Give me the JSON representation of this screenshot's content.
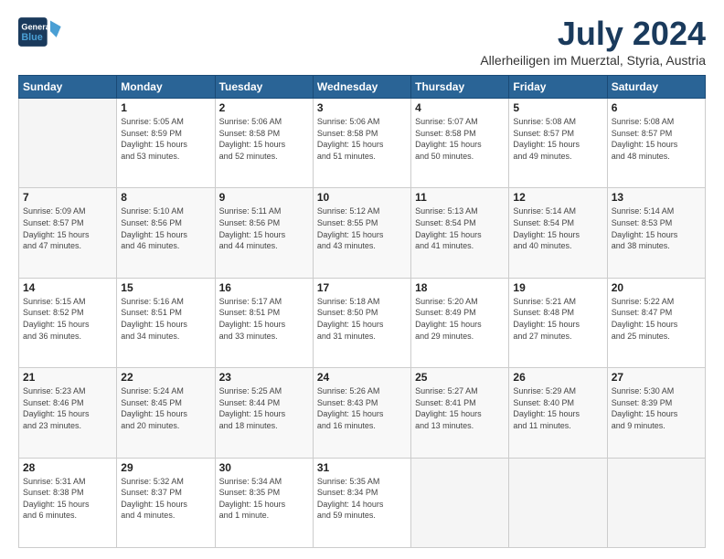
{
  "logo": {
    "line1": "General",
    "line2": "Blue"
  },
  "title": "July 2024",
  "subtitle": "Allerheiligen im Muerztal, Styria, Austria",
  "header_days": [
    "Sunday",
    "Monday",
    "Tuesday",
    "Wednesday",
    "Thursday",
    "Friday",
    "Saturday"
  ],
  "weeks": [
    [
      {
        "day": "",
        "content": ""
      },
      {
        "day": "1",
        "content": "Sunrise: 5:05 AM\nSunset: 8:59 PM\nDaylight: 15 hours\nand 53 minutes."
      },
      {
        "day": "2",
        "content": "Sunrise: 5:06 AM\nSunset: 8:58 PM\nDaylight: 15 hours\nand 52 minutes."
      },
      {
        "day": "3",
        "content": "Sunrise: 5:06 AM\nSunset: 8:58 PM\nDaylight: 15 hours\nand 51 minutes."
      },
      {
        "day": "4",
        "content": "Sunrise: 5:07 AM\nSunset: 8:58 PM\nDaylight: 15 hours\nand 50 minutes."
      },
      {
        "day": "5",
        "content": "Sunrise: 5:08 AM\nSunset: 8:57 PM\nDaylight: 15 hours\nand 49 minutes."
      },
      {
        "day": "6",
        "content": "Sunrise: 5:08 AM\nSunset: 8:57 PM\nDaylight: 15 hours\nand 48 minutes."
      }
    ],
    [
      {
        "day": "7",
        "content": "Sunrise: 5:09 AM\nSunset: 8:57 PM\nDaylight: 15 hours\nand 47 minutes."
      },
      {
        "day": "8",
        "content": "Sunrise: 5:10 AM\nSunset: 8:56 PM\nDaylight: 15 hours\nand 46 minutes."
      },
      {
        "day": "9",
        "content": "Sunrise: 5:11 AM\nSunset: 8:56 PM\nDaylight: 15 hours\nand 44 minutes."
      },
      {
        "day": "10",
        "content": "Sunrise: 5:12 AM\nSunset: 8:55 PM\nDaylight: 15 hours\nand 43 minutes."
      },
      {
        "day": "11",
        "content": "Sunrise: 5:13 AM\nSunset: 8:54 PM\nDaylight: 15 hours\nand 41 minutes."
      },
      {
        "day": "12",
        "content": "Sunrise: 5:14 AM\nSunset: 8:54 PM\nDaylight: 15 hours\nand 40 minutes."
      },
      {
        "day": "13",
        "content": "Sunrise: 5:14 AM\nSunset: 8:53 PM\nDaylight: 15 hours\nand 38 minutes."
      }
    ],
    [
      {
        "day": "14",
        "content": "Sunrise: 5:15 AM\nSunset: 8:52 PM\nDaylight: 15 hours\nand 36 minutes."
      },
      {
        "day": "15",
        "content": "Sunrise: 5:16 AM\nSunset: 8:51 PM\nDaylight: 15 hours\nand 34 minutes."
      },
      {
        "day": "16",
        "content": "Sunrise: 5:17 AM\nSunset: 8:51 PM\nDaylight: 15 hours\nand 33 minutes."
      },
      {
        "day": "17",
        "content": "Sunrise: 5:18 AM\nSunset: 8:50 PM\nDaylight: 15 hours\nand 31 minutes."
      },
      {
        "day": "18",
        "content": "Sunrise: 5:20 AM\nSunset: 8:49 PM\nDaylight: 15 hours\nand 29 minutes."
      },
      {
        "day": "19",
        "content": "Sunrise: 5:21 AM\nSunset: 8:48 PM\nDaylight: 15 hours\nand 27 minutes."
      },
      {
        "day": "20",
        "content": "Sunrise: 5:22 AM\nSunset: 8:47 PM\nDaylight: 15 hours\nand 25 minutes."
      }
    ],
    [
      {
        "day": "21",
        "content": "Sunrise: 5:23 AM\nSunset: 8:46 PM\nDaylight: 15 hours\nand 23 minutes."
      },
      {
        "day": "22",
        "content": "Sunrise: 5:24 AM\nSunset: 8:45 PM\nDaylight: 15 hours\nand 20 minutes."
      },
      {
        "day": "23",
        "content": "Sunrise: 5:25 AM\nSunset: 8:44 PM\nDaylight: 15 hours\nand 18 minutes."
      },
      {
        "day": "24",
        "content": "Sunrise: 5:26 AM\nSunset: 8:43 PM\nDaylight: 15 hours\nand 16 minutes."
      },
      {
        "day": "25",
        "content": "Sunrise: 5:27 AM\nSunset: 8:41 PM\nDaylight: 15 hours\nand 13 minutes."
      },
      {
        "day": "26",
        "content": "Sunrise: 5:29 AM\nSunset: 8:40 PM\nDaylight: 15 hours\nand 11 minutes."
      },
      {
        "day": "27",
        "content": "Sunrise: 5:30 AM\nSunset: 8:39 PM\nDaylight: 15 hours\nand 9 minutes."
      }
    ],
    [
      {
        "day": "28",
        "content": "Sunrise: 5:31 AM\nSunset: 8:38 PM\nDaylight: 15 hours\nand 6 minutes."
      },
      {
        "day": "29",
        "content": "Sunrise: 5:32 AM\nSunset: 8:37 PM\nDaylight: 15 hours\nand 4 minutes."
      },
      {
        "day": "30",
        "content": "Sunrise: 5:34 AM\nSunset: 8:35 PM\nDaylight: 15 hours\nand 1 minute."
      },
      {
        "day": "31",
        "content": "Sunrise: 5:35 AM\nSunset: 8:34 PM\nDaylight: 14 hours\nand 59 minutes."
      },
      {
        "day": "",
        "content": ""
      },
      {
        "day": "",
        "content": ""
      },
      {
        "day": "",
        "content": ""
      }
    ]
  ]
}
